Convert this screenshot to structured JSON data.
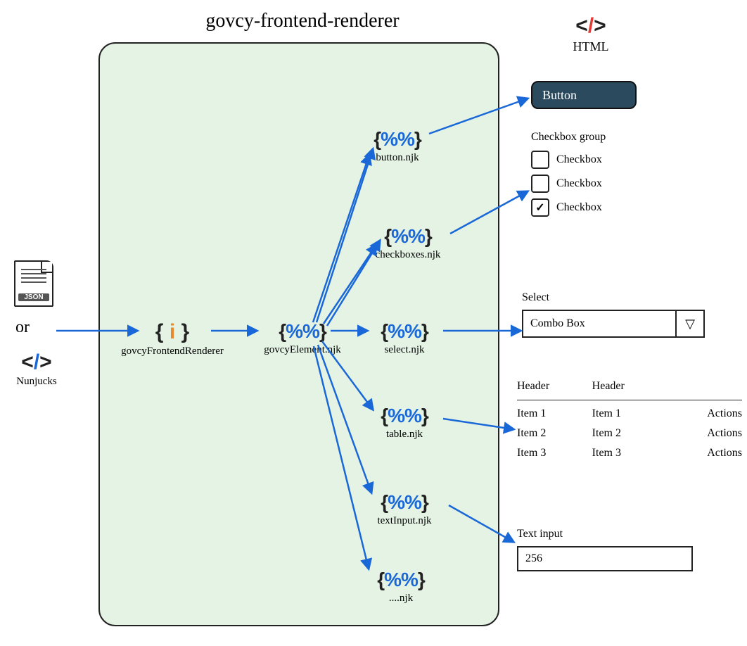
{
  "title": "govcy-frontend-renderer",
  "inputs": {
    "json_label": "JSON",
    "or": "or",
    "nunjucks_label": "Nunjucks"
  },
  "renderer": {
    "entry_label": "govcyFrontendRenderer",
    "dispatcher_label": "govcyElement.njk",
    "templates": [
      "button.njk",
      "checkboxes.njk",
      "select.njk",
      "table.njk",
      "textInput.njk",
      "....njk"
    ]
  },
  "html": {
    "heading": "HTML",
    "button_label": "Button",
    "checkbox_group": {
      "legend": "Checkbox group",
      "items": [
        {
          "label": "Checkbox",
          "checked": false
        },
        {
          "label": "Checkbox",
          "checked": false
        },
        {
          "label": "Checkbox",
          "checked": true
        }
      ]
    },
    "select": {
      "legend": "Select",
      "value": "Combo Box"
    },
    "table": {
      "headers": [
        "Header",
        "Header",
        ""
      ],
      "rows": [
        [
          "Item 1",
          "Item 1",
          "Actions"
        ],
        [
          "Item 2",
          "Item 2",
          "Actions"
        ],
        [
          "Item 3",
          "Item 3",
          "Actions"
        ]
      ]
    },
    "text_input": {
      "legend": "Text input",
      "value": "256"
    }
  }
}
